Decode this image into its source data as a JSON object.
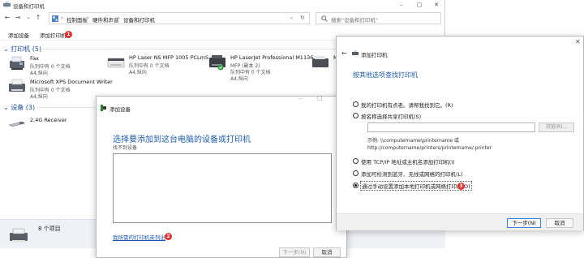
{
  "colors": {
    "accent": "#1f5fae",
    "badge": "#e5322d",
    "link": "#1a56b8"
  },
  "main": {
    "title": "设备和打印机",
    "breadcrumb": [
      "控制面板",
      "硬件和声音",
      "设备和打印机"
    ],
    "search_placeholder": "搜索\"设备和打印机\"",
    "toolbar": {
      "add_device": "添加设备",
      "add_printer": "添加打印机"
    },
    "printers_group": "打印机 (5)",
    "devices_group": "设备 (3)",
    "printers": [
      {
        "name": "Fax",
        "line1": "队列中有 0 个文档",
        "line2": "A4,纵向",
        "icon": "fax-icon"
      },
      {
        "name": "HP Laser NS MFP 1005 PCLmS",
        "line1": "队列中有 0 个文档",
        "line2": "A4,纵向",
        "icon": "printer-icon"
      },
      {
        "name": "HP LaserJet Professional M1136",
        "name2": "MFP (副本 2)",
        "line1": "队列中有 0 个文档",
        "line2": "A4,纵向",
        "icon": "printer-default-icon"
      },
      {
        "name": "Mi",
        "icon": "printer-icon"
      },
      {
        "name": "Microsoft XPS Document Writer",
        "line1": "队列中有 0 个文档",
        "line2": "A4,纵向",
        "icon": "printer-icon"
      }
    ],
    "devices": [
      {
        "name": "2.4G Receiver",
        "icon": "receiver-icon"
      }
    ],
    "item_count": "8 个项目"
  },
  "badges": [
    "1",
    "2",
    "3"
  ],
  "add_device_dialog": {
    "title": "添加设备",
    "heading": "选择要添加到这台电脑的设备或打印机",
    "subheading": "找不到设备",
    "link": "我所需的打印机未列出",
    "next": "下一步(N)",
    "cancel": "取消"
  },
  "add_printer_dialog": {
    "title": "添加打印机",
    "heading": "按其他选项查找打印机",
    "options": [
      "我的打印机有点老。请帮我找到它。(R)",
      "按名称选择共享打印机(S)",
      "使用 TCP/IP 地址或主机名添加打印机(I)",
      "添加可检测到蓝牙、无线或网络的打印机(L)",
      "通过手动设置添加本地打印机或网络打印机(O)"
    ],
    "selected_option": 4,
    "browse": "浏览(R)...",
    "example_line1": "示例: \\\\computername\\printername 或",
    "example_line2": "http://computername/printers/printername/.printer",
    "next": "下一步(N)",
    "cancel": "取消"
  }
}
